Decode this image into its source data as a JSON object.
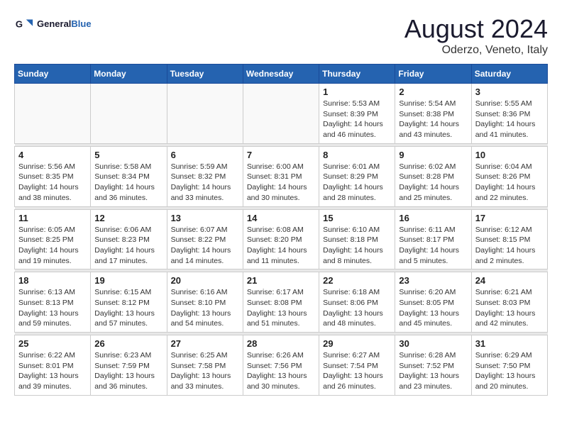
{
  "header": {
    "logo_general": "General",
    "logo_blue": "Blue",
    "month_year": "August 2024",
    "location": "Oderzo, Veneto, Italy"
  },
  "weekdays": [
    "Sunday",
    "Monday",
    "Tuesday",
    "Wednesday",
    "Thursday",
    "Friday",
    "Saturday"
  ],
  "weeks": [
    [
      {
        "day": "",
        "info": ""
      },
      {
        "day": "",
        "info": ""
      },
      {
        "day": "",
        "info": ""
      },
      {
        "day": "",
        "info": ""
      },
      {
        "day": "1",
        "info": "Sunrise: 5:53 AM\nSunset: 8:39 PM\nDaylight: 14 hours\nand 46 minutes."
      },
      {
        "day": "2",
        "info": "Sunrise: 5:54 AM\nSunset: 8:38 PM\nDaylight: 14 hours\nand 43 minutes."
      },
      {
        "day": "3",
        "info": "Sunrise: 5:55 AM\nSunset: 8:36 PM\nDaylight: 14 hours\nand 41 minutes."
      }
    ],
    [
      {
        "day": "4",
        "info": "Sunrise: 5:56 AM\nSunset: 8:35 PM\nDaylight: 14 hours\nand 38 minutes."
      },
      {
        "day": "5",
        "info": "Sunrise: 5:58 AM\nSunset: 8:34 PM\nDaylight: 14 hours\nand 36 minutes."
      },
      {
        "day": "6",
        "info": "Sunrise: 5:59 AM\nSunset: 8:32 PM\nDaylight: 14 hours\nand 33 minutes."
      },
      {
        "day": "7",
        "info": "Sunrise: 6:00 AM\nSunset: 8:31 PM\nDaylight: 14 hours\nand 30 minutes."
      },
      {
        "day": "8",
        "info": "Sunrise: 6:01 AM\nSunset: 8:29 PM\nDaylight: 14 hours\nand 28 minutes."
      },
      {
        "day": "9",
        "info": "Sunrise: 6:02 AM\nSunset: 8:28 PM\nDaylight: 14 hours\nand 25 minutes."
      },
      {
        "day": "10",
        "info": "Sunrise: 6:04 AM\nSunset: 8:26 PM\nDaylight: 14 hours\nand 22 minutes."
      }
    ],
    [
      {
        "day": "11",
        "info": "Sunrise: 6:05 AM\nSunset: 8:25 PM\nDaylight: 14 hours\nand 19 minutes."
      },
      {
        "day": "12",
        "info": "Sunrise: 6:06 AM\nSunset: 8:23 PM\nDaylight: 14 hours\nand 17 minutes."
      },
      {
        "day": "13",
        "info": "Sunrise: 6:07 AM\nSunset: 8:22 PM\nDaylight: 14 hours\nand 14 minutes."
      },
      {
        "day": "14",
        "info": "Sunrise: 6:08 AM\nSunset: 8:20 PM\nDaylight: 14 hours\nand 11 minutes."
      },
      {
        "day": "15",
        "info": "Sunrise: 6:10 AM\nSunset: 8:18 PM\nDaylight: 14 hours\nand 8 minutes."
      },
      {
        "day": "16",
        "info": "Sunrise: 6:11 AM\nSunset: 8:17 PM\nDaylight: 14 hours\nand 5 minutes."
      },
      {
        "day": "17",
        "info": "Sunrise: 6:12 AM\nSunset: 8:15 PM\nDaylight: 14 hours\nand 2 minutes."
      }
    ],
    [
      {
        "day": "18",
        "info": "Sunrise: 6:13 AM\nSunset: 8:13 PM\nDaylight: 13 hours\nand 59 minutes."
      },
      {
        "day": "19",
        "info": "Sunrise: 6:15 AM\nSunset: 8:12 PM\nDaylight: 13 hours\nand 57 minutes."
      },
      {
        "day": "20",
        "info": "Sunrise: 6:16 AM\nSunset: 8:10 PM\nDaylight: 13 hours\nand 54 minutes."
      },
      {
        "day": "21",
        "info": "Sunrise: 6:17 AM\nSunset: 8:08 PM\nDaylight: 13 hours\nand 51 minutes."
      },
      {
        "day": "22",
        "info": "Sunrise: 6:18 AM\nSunset: 8:06 PM\nDaylight: 13 hours\nand 48 minutes."
      },
      {
        "day": "23",
        "info": "Sunrise: 6:20 AM\nSunset: 8:05 PM\nDaylight: 13 hours\nand 45 minutes."
      },
      {
        "day": "24",
        "info": "Sunrise: 6:21 AM\nSunset: 8:03 PM\nDaylight: 13 hours\nand 42 minutes."
      }
    ],
    [
      {
        "day": "25",
        "info": "Sunrise: 6:22 AM\nSunset: 8:01 PM\nDaylight: 13 hours\nand 39 minutes."
      },
      {
        "day": "26",
        "info": "Sunrise: 6:23 AM\nSunset: 7:59 PM\nDaylight: 13 hours\nand 36 minutes."
      },
      {
        "day": "27",
        "info": "Sunrise: 6:25 AM\nSunset: 7:58 PM\nDaylight: 13 hours\nand 33 minutes."
      },
      {
        "day": "28",
        "info": "Sunrise: 6:26 AM\nSunset: 7:56 PM\nDaylight: 13 hours\nand 30 minutes."
      },
      {
        "day": "29",
        "info": "Sunrise: 6:27 AM\nSunset: 7:54 PM\nDaylight: 13 hours\nand 26 minutes."
      },
      {
        "day": "30",
        "info": "Sunrise: 6:28 AM\nSunset: 7:52 PM\nDaylight: 13 hours\nand 23 minutes."
      },
      {
        "day": "31",
        "info": "Sunrise: 6:29 AM\nSunset: 7:50 PM\nDaylight: 13 hours\nand 20 minutes."
      }
    ]
  ]
}
